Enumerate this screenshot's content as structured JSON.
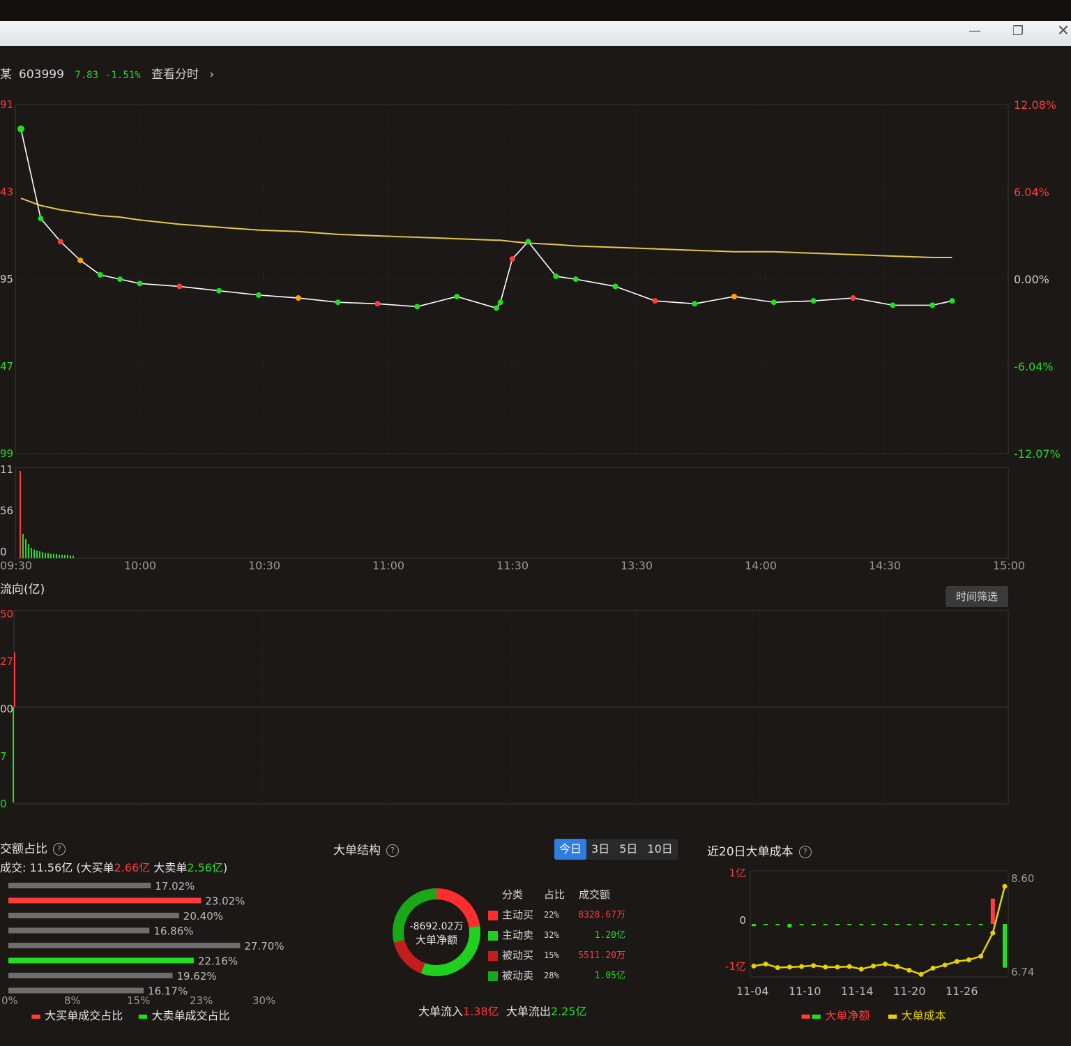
{
  "window": {
    "minimize_icon": "minimize-icon",
    "restore_icon": "restore-icon",
    "close_icon": "close-icon"
  },
  "header": {
    "name_fragment": "某",
    "code": "603999",
    "price": "7.83",
    "change_pct": "-1.51%",
    "view_timeshare": "查看分时",
    "arrow": "›"
  },
  "colors": {
    "up": "#ff3b3b",
    "down": "#22dd22",
    "avg_line": "#e6c84a",
    "price_line": "#ffffff",
    "grid": "#3a3a3a",
    "accent": "#2f7de1"
  },
  "chart_data": [
    {
      "type": "line",
      "name": "intraday_price",
      "left_axis_ticks": [
        "91",
        "43",
        "95",
        "47",
        "99"
      ],
      "right_axis_ticks": [
        "12.08%",
        "6.04%",
        "0.00%",
        "-6.04%",
        "-12.07%"
      ],
      "ylim_pct": [
        -12.07,
        12.08
      ],
      "x_ticks": [
        "09:30",
        "10:00",
        "10:30",
        "11:00",
        "11:30",
        "13:30",
        "14:00",
        "14:30",
        "15:00"
      ],
      "x_minutes": [
        0,
        5,
        10,
        15,
        20,
        25,
        30,
        40,
        50,
        60,
        70,
        80,
        90,
        100,
        110,
        120,
        121,
        124,
        128,
        135,
        140,
        150,
        160,
        170,
        180,
        190,
        200,
        210,
        220,
        230,
        235
      ],
      "series": [
        {
          "values": [
            10.4,
            4.2,
            2.6,
            1.3,
            0.3,
            0.0,
            -0.3,
            -0.5,
            -0.8,
            -1.1,
            -1.3,
            -1.6,
            -1.7,
            -1.9,
            -1.2,
            -2.0,
            -1.6,
            1.4,
            2.6,
            0.2,
            0.0,
            -0.5,
            -1.5,
            -1.7,
            -1.2,
            -1.6,
            -1.5,
            -1.3,
            -1.8,
            -1.8,
            -1.5
          ]
        },
        {
          "values": [
            5.6,
            5.1,
            4.8,
            4.6,
            4.4,
            4.3,
            4.1,
            3.8,
            3.6,
            3.4,
            3.3,
            3.1,
            3.0,
            2.9,
            2.8,
            2.7,
            2.7,
            2.6,
            2.5,
            2.4,
            2.3,
            2.2,
            2.1,
            2.0,
            1.9,
            1.9,
            1.8,
            1.7,
            1.6,
            1.5,
            1.5
          ]
        }
      ]
    },
    {
      "type": "bar",
      "name": "intraday_volume",
      "left_axis_ticks": [
        "11",
        "56",
        "0"
      ],
      "values": [
        100,
        28,
        22,
        16,
        12,
        10,
        9,
        8,
        7,
        6,
        6,
        5,
        5,
        5,
        4,
        4,
        4,
        4,
        3,
        3
      ]
    },
    {
      "type": "bar",
      "name": "fund_flow",
      "title": "流向(亿)",
      "left_axis_ticks": [
        "50",
        "27",
        "00",
        "7",
        "0"
      ]
    },
    {
      "type": "bar",
      "name": "turnover_ratio",
      "title": "交额占比",
      "x_ticks": [
        "0%",
        "8%",
        "15%",
        "23%",
        "30%"
      ],
      "xlim": [
        0,
        30
      ],
      "series": [
        {
          "name": "大买单成交占比",
          "values": [
            23.02
          ]
        },
        {
          "name": "大卖单成交占比",
          "values": [
            22.16
          ]
        }
      ],
      "bars": [
        {
          "value": 17.02,
          "label": "17.02%",
          "kind": "gray"
        },
        {
          "value": 23.02,
          "label": "23.02%",
          "kind": "red"
        },
        {
          "value": 20.4,
          "label": "20.40%",
          "kind": "gray"
        },
        {
          "value": 16.86,
          "label": "16.86%",
          "kind": "gray"
        },
        {
          "value": 27.7,
          "label": "27.70%",
          "kind": "gray"
        },
        {
          "value": 22.16,
          "label": "22.16%",
          "kind": "green"
        },
        {
          "value": 19.62,
          "label": "19.62%",
          "kind": "gray"
        },
        {
          "value": 16.17,
          "label": "16.17%",
          "kind": "gray"
        }
      ]
    },
    {
      "type": "pie",
      "name": "big_order_structure",
      "title": "大单结构",
      "center_value": "-8692.02万",
      "center_label": "大单净额",
      "slices": [
        {
          "name": "主动买",
          "pct": 22,
          "color": "#ff2d2d"
        },
        {
          "name": "主动卖",
          "pct": 32,
          "color": "#1fd11f"
        },
        {
          "name": "被动买",
          "pct": 15,
          "color": "#c41d1d"
        },
        {
          "name": "被动卖",
          "pct": 28,
          "color": "#18a818"
        }
      ]
    },
    {
      "type": "line",
      "name": "big_order_cost_20d",
      "title": "近20日大单成本",
      "left_axis_ticks": [
        "1亿",
        "0",
        "-1亿"
      ],
      "right_axis_ticks": [
        "8.60",
        "6.74"
      ],
      "x_ticks": [
        "11-04",
        "11-10",
        "11-14",
        "11-20",
        "11-26"
      ],
      "series": [
        {
          "name": "大单成本",
          "values": [
            6.76,
            6.8,
            6.73,
            6.74,
            6.75,
            6.77,
            6.74,
            6.74,
            6.75,
            6.7,
            6.76,
            6.8,
            6.75,
            6.68,
            6.6,
            6.72,
            6.78,
            6.85,
            6.88,
            6.95,
            7.4,
            8.3
          ]
        },
        {
          "name": "大单净额",
          "values": [
            -0.05,
            -0.02,
            -0.02,
            -0.08,
            -0.02,
            -0.02,
            -0.02,
            -0.02,
            -0.03,
            -0.03,
            -0.02,
            -0.03,
            -0.02,
            -0.02,
            -0.02,
            -0.02,
            -0.02,
            -0.02,
            -0.02,
            -0.02,
            0.55,
            -0.95
          ]
        }
      ]
    }
  ],
  "flow": {
    "filter_button": "时间筛选"
  },
  "ratio": {
    "summary_prefix": "成交: 11.56亿 (大买单",
    "big_buy": "2.66亿",
    "summary_mid": " 大卖单",
    "big_sell": "2.56亿",
    "summary_suffix": ")",
    "legend_buy": "大买单成交占比",
    "legend_sell": "大卖单成交占比"
  },
  "structure": {
    "tabs": [
      "今日",
      "3日",
      "5日",
      "10日"
    ],
    "table_headers": [
      "分类",
      "占比",
      "成交额"
    ],
    "rows": [
      {
        "cat": "主动买",
        "pct": "22%",
        "amt": "8328.67万",
        "kind": "up"
      },
      {
        "cat": "主动卖",
        "pct": "32%",
        "amt": "1.20亿",
        "kind": "down"
      },
      {
        "cat": "被动买",
        "pct": "15%",
        "amt": "5511.20万",
        "kind": "up"
      },
      {
        "cat": "被动卖",
        "pct": "28%",
        "amt": "1.05亿",
        "kind": "down"
      }
    ],
    "inflow_label": "大单流入",
    "inflow_value": "1.38亿",
    "outflow_label": "大单流出",
    "outflow_value": "2.25亿"
  },
  "cost20": {
    "legend_net": "大单净额",
    "legend_cost": "大单成本"
  }
}
